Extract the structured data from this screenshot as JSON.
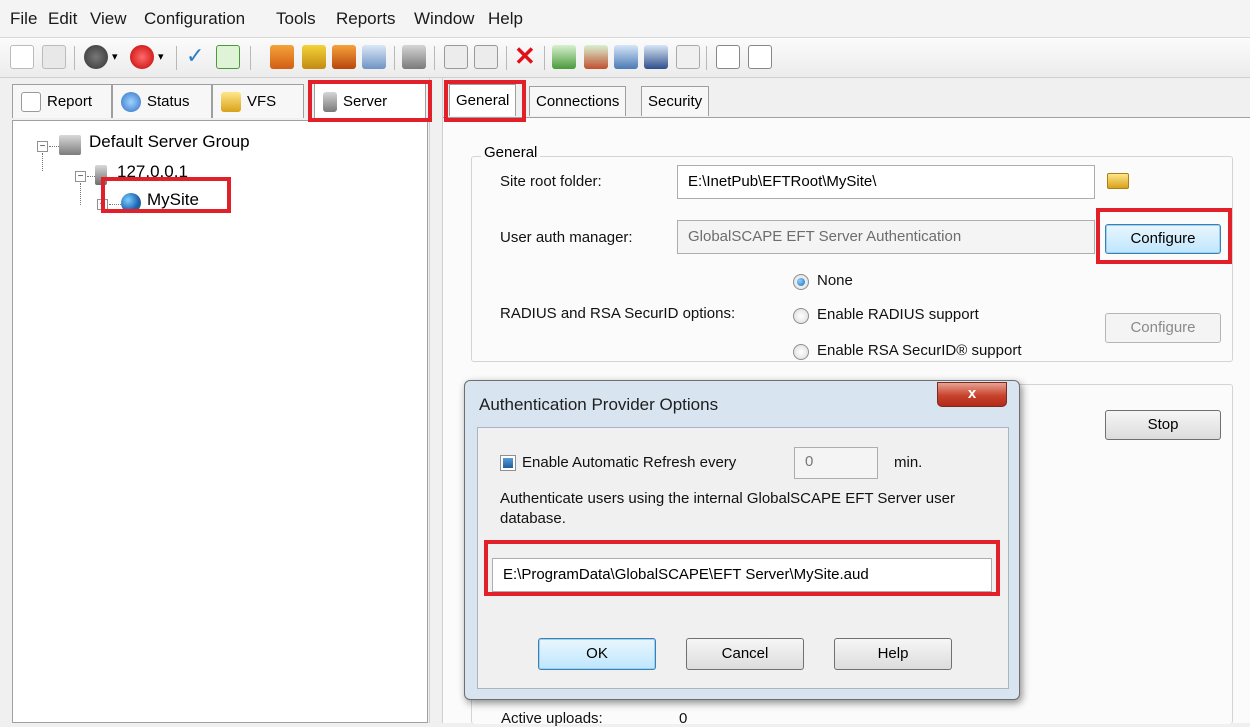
{
  "menu": [
    "File",
    "Edit",
    "View",
    "Configuration",
    "Tools",
    "Reports",
    "Window",
    "Help"
  ],
  "left_tabs": {
    "report": "Report",
    "status": "Status",
    "vfs": "VFS",
    "server": "Server"
  },
  "tree": {
    "group": "Default Server Group",
    "server": "127.0.0.1",
    "site": "MySite"
  },
  "right_tabs": {
    "general": "General",
    "connections": "Connections",
    "security": "Security"
  },
  "general": {
    "group_title": "General",
    "site_root_label": "Site root folder:",
    "site_root_value": "E:\\InetPub\\EFTRoot\\MySite\\",
    "auth_label": "User auth manager:",
    "auth_value": "GlobalSCAPE EFT Server Authentication",
    "configure_label": "Configure",
    "radius_label": "RADIUS and RSA SecurID options:",
    "opt_none": "None",
    "opt_radius": "Enable RADIUS support",
    "opt_rsa": "Enable RSA SecurID® support",
    "configure2_label": "Configure"
  },
  "status_section": {
    "stop_label": "Stop",
    "active_uploads_label": "Active uploads:",
    "active_uploads_value": "0"
  },
  "dialog": {
    "title": "Authentication Provider Options",
    "close_label": "x",
    "refresh_label": "Enable Automatic Refresh every",
    "refresh_value": "0",
    "refresh_unit": "min.",
    "description": "Authenticate users using the internal GlobalSCAPE EFT Server user database.",
    "path_value": "E:\\ProgramData\\GlobalSCAPE\\EFT Server\\MySite.aud",
    "ok_label": "OK",
    "cancel_label": "Cancel",
    "help_label": "Help"
  },
  "colors": {
    "highlight": "#e2202a",
    "accent": "#1f5f9e"
  }
}
